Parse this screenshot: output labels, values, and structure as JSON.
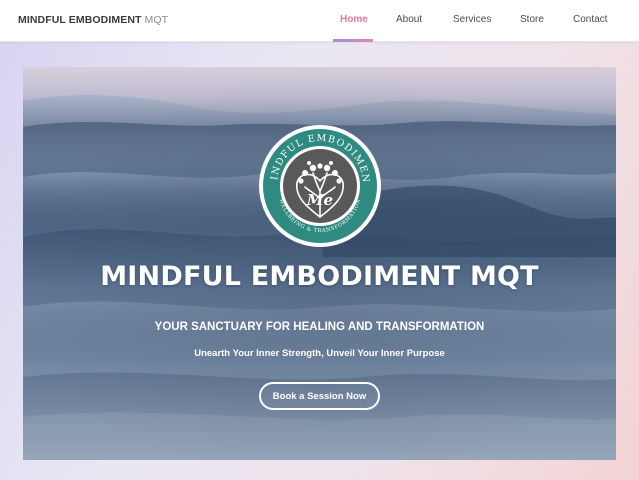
{
  "header": {
    "brand_bold": "MINDFUL EMBODIMENT",
    "brand_light": "MQT",
    "nav": [
      {
        "label": "Home",
        "active": true
      },
      {
        "label": "About",
        "active": false
      },
      {
        "label": "Services",
        "active": false
      },
      {
        "label": "Store",
        "active": false
      },
      {
        "label": "Contact",
        "active": false
      }
    ]
  },
  "hero": {
    "logo": {
      "top_text": "MINDFUL EMBODIMENT",
      "bottom_text": "WELLBEING & TRANSFORMATION",
      "monogram": "Me",
      "ring_color": "#2f8a82"
    },
    "title": "MINDFUL EMBODIMENT MQT",
    "subtitle": "YOUR SANCTUARY FOR HEALING AND TRANSFORMATION",
    "tagline": "Unearth Your Inner Strength, Unveil Your Inner Purpose",
    "cta_label": "Book a Session Now"
  },
  "colors": {
    "accent_pink": "#e07aa0",
    "accent_purple": "#9f8de8",
    "teal": "#2f8a82"
  }
}
